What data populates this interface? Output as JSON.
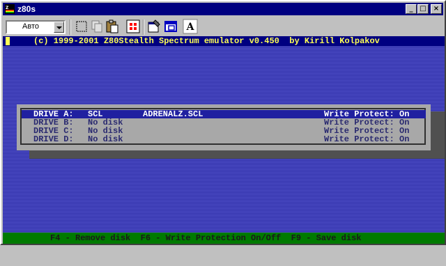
{
  "window": {
    "title": "z80s",
    "buttons": {
      "minimize": "_",
      "maximize": "□",
      "close": "×"
    }
  },
  "toolbar": {
    "font_select": {
      "value": "Авто"
    },
    "tools": [
      {
        "name": "select-tool-icon"
      },
      {
        "name": "copy-icon"
      },
      {
        "name": "paste-icon"
      },
      {
        "name": "fullscreen-icon"
      },
      {
        "name": "properties-icon"
      },
      {
        "name": "background-icon"
      },
      {
        "name": "font-icon",
        "label": "A"
      }
    ]
  },
  "screen": {
    "banner": "(c) 1999-2001 Z80Stealth Spectrum emulator v0.450  by Kirill Kolpakov",
    "drives": [
      {
        "drive": "DRIVE A:",
        "type": "SCL",
        "file": "ADRENALZ.SCL",
        "wp": "Write Protect: On",
        "selected": true
      },
      {
        "drive": "DRIVE B:",
        "type": "No disk",
        "file": "",
        "wp": "Write Protect: On",
        "selected": false
      },
      {
        "drive": "DRIVE C:",
        "type": "No disk",
        "file": "",
        "wp": "Write Protect: On",
        "selected": false
      },
      {
        "drive": "DRIVE D:",
        "type": "No disk",
        "file": "",
        "wp": "Write Protect: On",
        "selected": false
      }
    ],
    "status": "F4 - Remove disk  F6 - Write Protection On/Off  F9 - Save disk"
  },
  "colors": {
    "titlebar": "#000080",
    "screen_bg": "#3a3ab0",
    "banner_text": "#ffff55",
    "panel": "#a8a8a8",
    "selection": "#2020a0",
    "statusbar": "#007a00"
  }
}
